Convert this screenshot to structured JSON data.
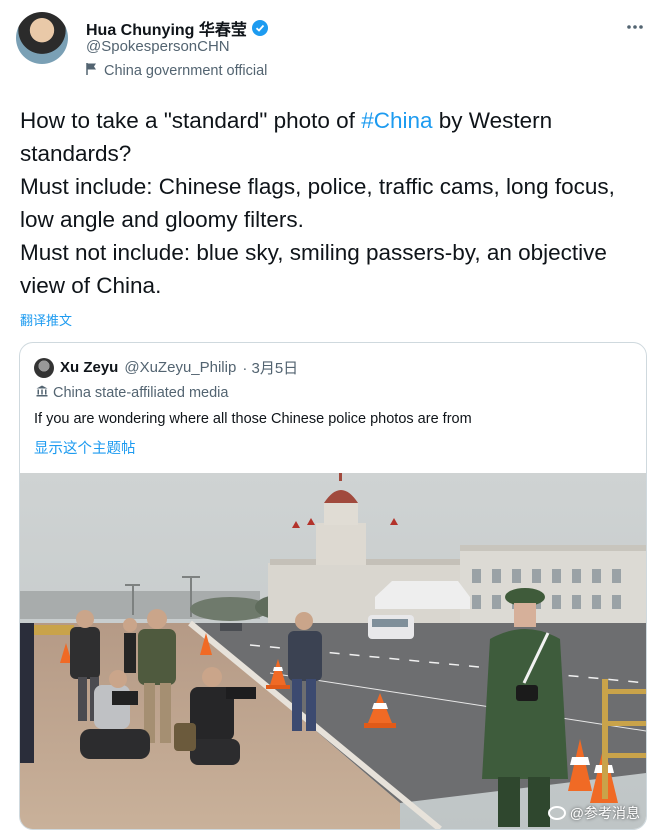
{
  "author": {
    "name": "Hua Chunying 华春莹",
    "handle": "@SpokespersonCHN",
    "label": "China government official",
    "more_icon": "more-horizontal-icon",
    "verified_color": "#1d9bf0"
  },
  "tweet": {
    "before_hashtag": "How to take a \"standard\" photo of ",
    "hashtag": "#China",
    "after_hashtag": " by Western standards?",
    "line2": "Must include: Chinese flags, police, traffic cams, long focus, low angle and gloomy filters.",
    "line3": "Must not include: blue sky, smiling passers-by, an objective view of China.",
    "translate_label": "翻译推文"
  },
  "quoted": {
    "name": "Xu Zeyu",
    "handle": "@XuZeyu_Philip",
    "date": "· 3月5日",
    "label": "China state-affiliated media",
    "text": "If you are wondering where all those Chinese police photos are from",
    "show_thread": "显示这个主题帖"
  },
  "watermark": "@参考消息",
  "colors": {
    "link": "#1d9bf0",
    "secondary_text": "#536471",
    "border": "#cfd9de"
  }
}
